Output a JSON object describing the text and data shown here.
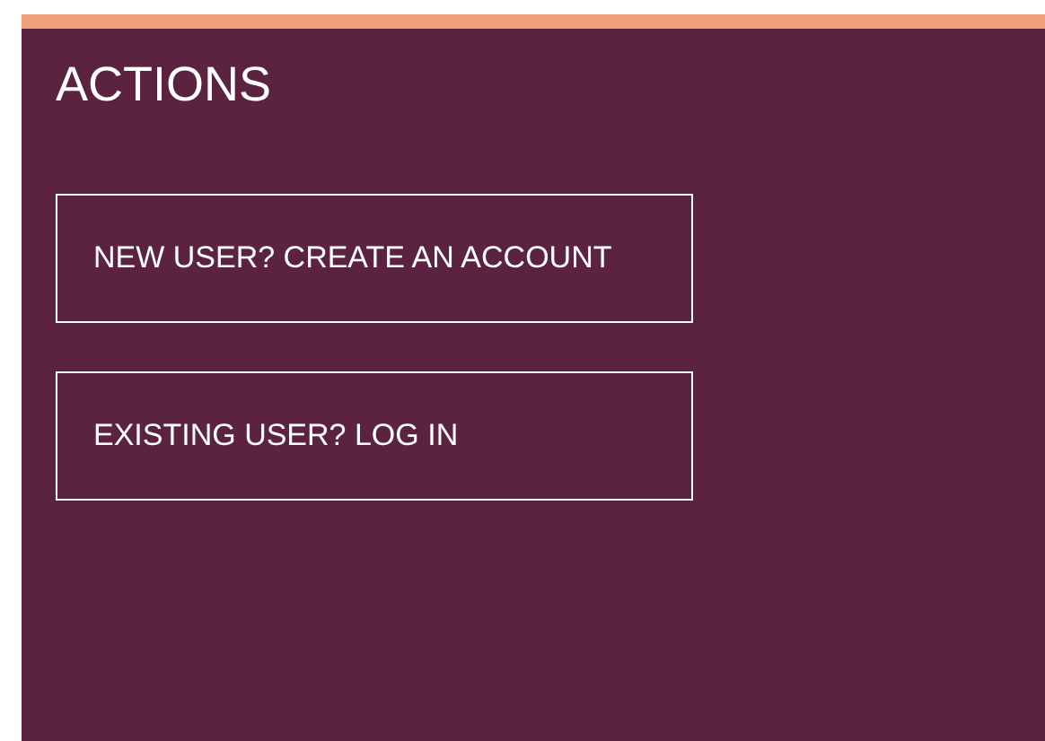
{
  "panel": {
    "title": "ACTIONS",
    "buttons": [
      {
        "label": "NEW USER? CREATE AN ACCOUNT"
      },
      {
        "label": "EXISTING USER? LOG IN"
      }
    ]
  }
}
